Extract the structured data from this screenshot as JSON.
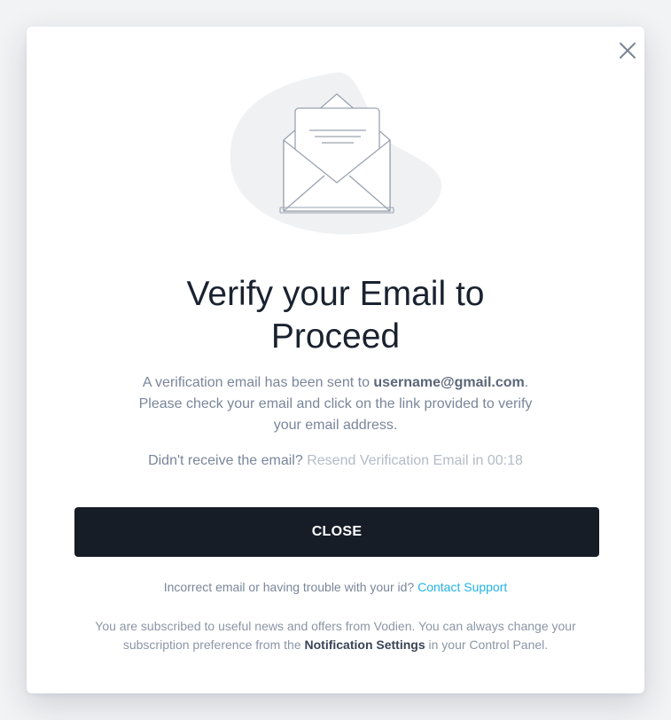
{
  "modal": {
    "close_icon": "close-icon",
    "illustration_icon": "open-envelope-icon",
    "title_line1": "Verify your Email to",
    "title_line2": "Proceed",
    "description": {
      "part1": "A verification email has been sent to ",
      "email": "username@gmail.com",
      "part2": ". Please check your email and click on the link provided to verify your email address."
    },
    "resend": {
      "prompt": "Didn't receive the email?",
      "action": "Resend Verification Email in 00:18"
    },
    "close_button_label": "CLOSE",
    "support": {
      "text": "Incorrect email or having trouble with your id?",
      "link": "Contact Support"
    },
    "footer": {
      "part1": "You are subscribed to useful news and offers from Vodien. You can always change your subscription preference from the ",
      "link": "Notification Settings",
      "part2": " in your Control Panel."
    }
  },
  "colors": {
    "button_bg": "#161d27",
    "link": "#22b3e6",
    "muted_text": "#7a869a",
    "title_text": "#1a2230",
    "blob": "#f0f1f3"
  }
}
